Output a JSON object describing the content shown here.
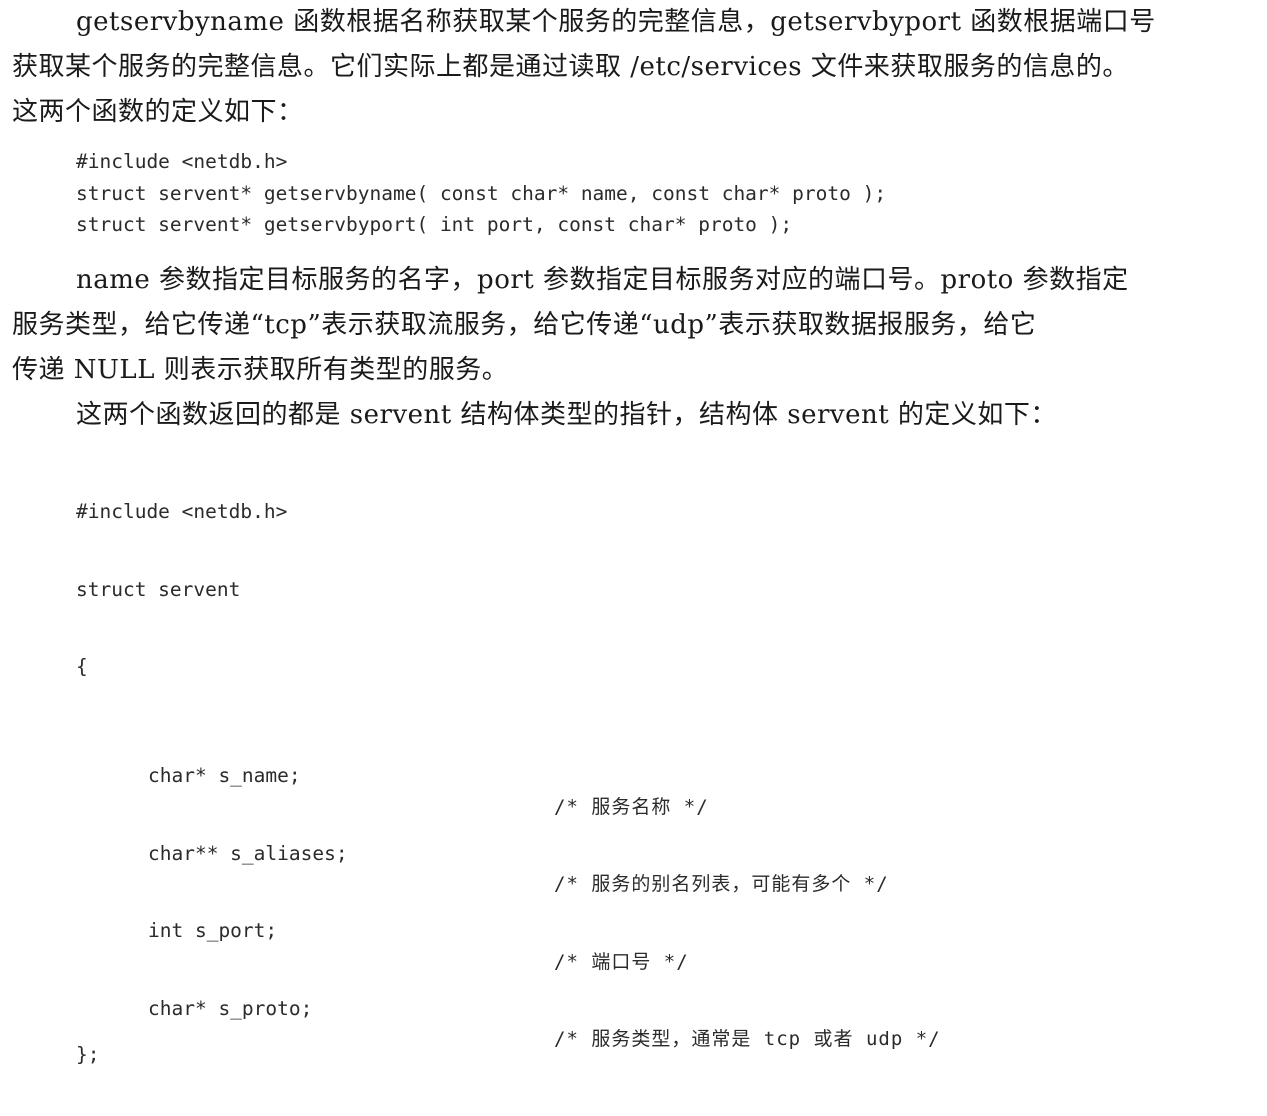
{
  "paragraph1": {
    "line1": "getservbyname 函数根据名称获取某个服务的完整信息，getservbyport 函数根据端口号",
    "line2": "获取某个服务的完整信息。它们实际上都是通过读取 /etc/services 文件来获取服务的信息的。",
    "line3": "这两个函数的定义如下："
  },
  "code1": [
    "#include <netdb.h>",
    "struct servent* getservbyname( const char* name, const char* proto );",
    "struct servent* getservbyport( int port, const char* proto );"
  ],
  "paragraph2": {
    "line1": "name 参数指定目标服务的名字，port 参数指定目标服务对应的端口号。proto 参数指定",
    "line2": "服务类型，给它传递“tcp”表示获取流服务，给它传递“udp”表示获取数据报服务，给它",
    "line3": "传递 NULL 则表示获取所有类型的服务。"
  },
  "paragraph3": {
    "line1": "这两个函数返回的都是 servent 结构体类型的指针，结构体 servent 的定义如下："
  },
  "code2": {
    "include": "#include <netdb.h>",
    "struct_decl": "struct servent",
    "open_brace": "{",
    "members": [
      {
        "decl": "char* s_name;",
        "comment": "/* 服务名称 */"
      },
      {
        "decl": "char** s_aliases;",
        "comment": "/* 服务的别名列表，可能有多个 */"
      },
      {
        "decl": "int s_port;",
        "comment": "/* 端口号 */"
      },
      {
        "decl": "char* s_proto;",
        "comment": "/* 服务类型，通常是 tcp 或者 udp */"
      }
    ],
    "close_brace": "};"
  }
}
